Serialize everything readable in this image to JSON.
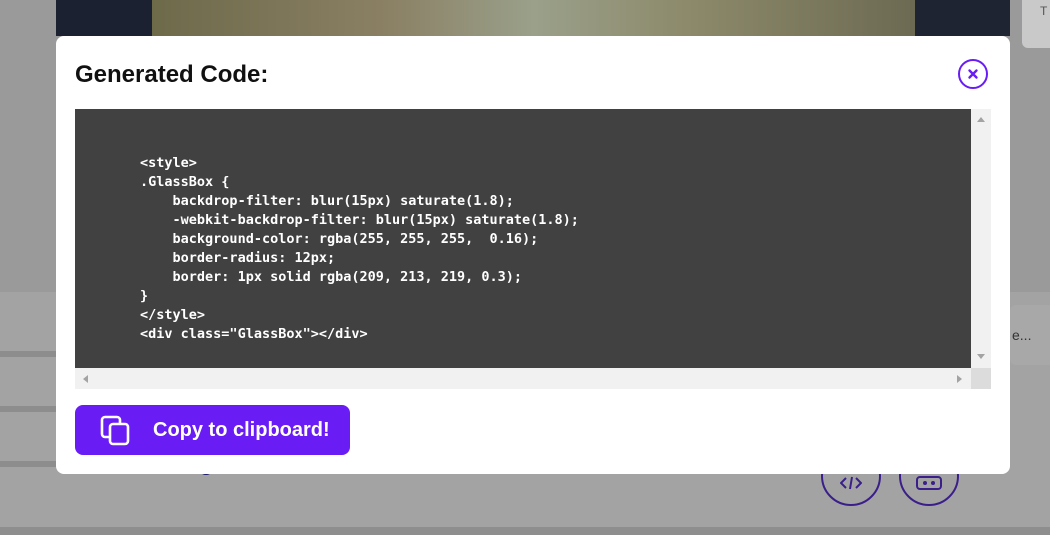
{
  "background": {
    "corner_card_text": "T",
    "side_tab_text": "e..."
  },
  "modal": {
    "title": "Generated Code:",
    "close_icon": "close-icon",
    "code": "\t<style>\n\t.GlassBox {\n\t    backdrop-filter: blur(15px) saturate(1.8);\n\t    -webkit-backdrop-filter: blur(15px) saturate(1.8);\n\t    background-color: rgba(255, 255, 255,  0.16);\n\t    border-radius: 12px;\n\t    border: 1px solid rgba(209, 213, 219, 0.3);\n\t}\n\t</style>\n\t<div class=\"GlassBox\"></div>",
    "copy_button": {
      "label": "Copy to clipboard!",
      "icon": "copy-icon"
    }
  },
  "colors": {
    "accent": "#6a1cf5",
    "code_background": "#414141",
    "overlay": "#9a9a9a"
  }
}
